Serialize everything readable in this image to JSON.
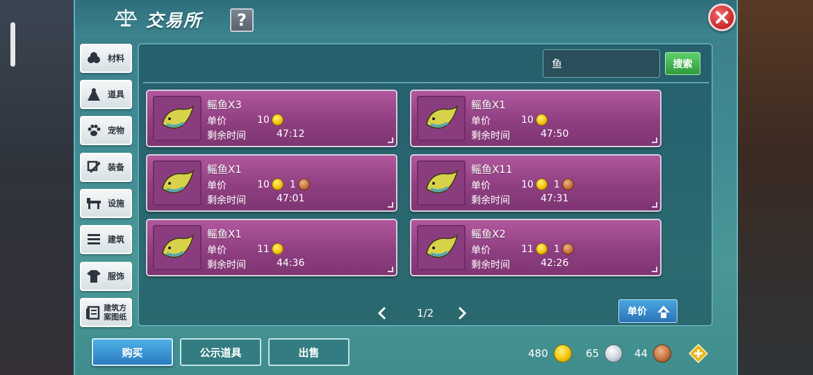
{
  "header": {
    "title": "交易所",
    "help_label": "?"
  },
  "sidebar": {
    "items": [
      {
        "label": "材料",
        "icon": "materials-icon"
      },
      {
        "label": "道具",
        "icon": "props-icon"
      },
      {
        "label": "宠物",
        "icon": "pet-paw-icon"
      },
      {
        "label": "装备",
        "icon": "equipment-icon"
      },
      {
        "label": "设施",
        "icon": "facility-icon"
      },
      {
        "label": "建筑",
        "icon": "building-icon"
      },
      {
        "label": "服饰",
        "icon": "clothing-icon"
      },
      {
        "label": "建筑方案图纸",
        "icon": "blueprint-icon"
      }
    ]
  },
  "search": {
    "value": "鱼",
    "button_label": "搜索"
  },
  "listings": [
    {
      "name": "鳐鱼X3",
      "price_label": "单价",
      "gold": "10",
      "bronze": "",
      "time_label": "剩余时间",
      "time": "47:12"
    },
    {
      "name": "鳐鱼X1",
      "price_label": "单价",
      "gold": "10",
      "bronze": "",
      "time_label": "剩余时间",
      "time": "47:50"
    },
    {
      "name": "鳐鱼X1",
      "price_label": "单价",
      "gold": "10",
      "bronze": "1",
      "time_label": "剩余时间",
      "time": "47:01"
    },
    {
      "name": "鳐鱼X11",
      "price_label": "单价",
      "gold": "10",
      "bronze": "1",
      "time_label": "剩余时间",
      "time": "47:31"
    },
    {
      "name": "鳐鱼X1",
      "price_label": "单价",
      "gold": "11",
      "bronze": "",
      "time_label": "剩余时间",
      "time": "44:36"
    },
    {
      "name": "鳐鱼X2",
      "price_label": "单价",
      "gold": "11",
      "bronze": "1",
      "time_label": "剩余时间",
      "time": "42:26"
    }
  ],
  "pager": {
    "text": "1/2"
  },
  "sort": {
    "label": "单价"
  },
  "bottom_tabs": {
    "buy": "购买",
    "public": "公示道具",
    "sell": "出售"
  },
  "currency": {
    "gold": "480",
    "silver": "65",
    "bronze": "44"
  },
  "colors": {
    "card": "#8f3f81",
    "panel": "#3f8a93",
    "active_tab": "#2b7cc0",
    "search_button": "#2f9b3d",
    "close": "#c62828"
  }
}
